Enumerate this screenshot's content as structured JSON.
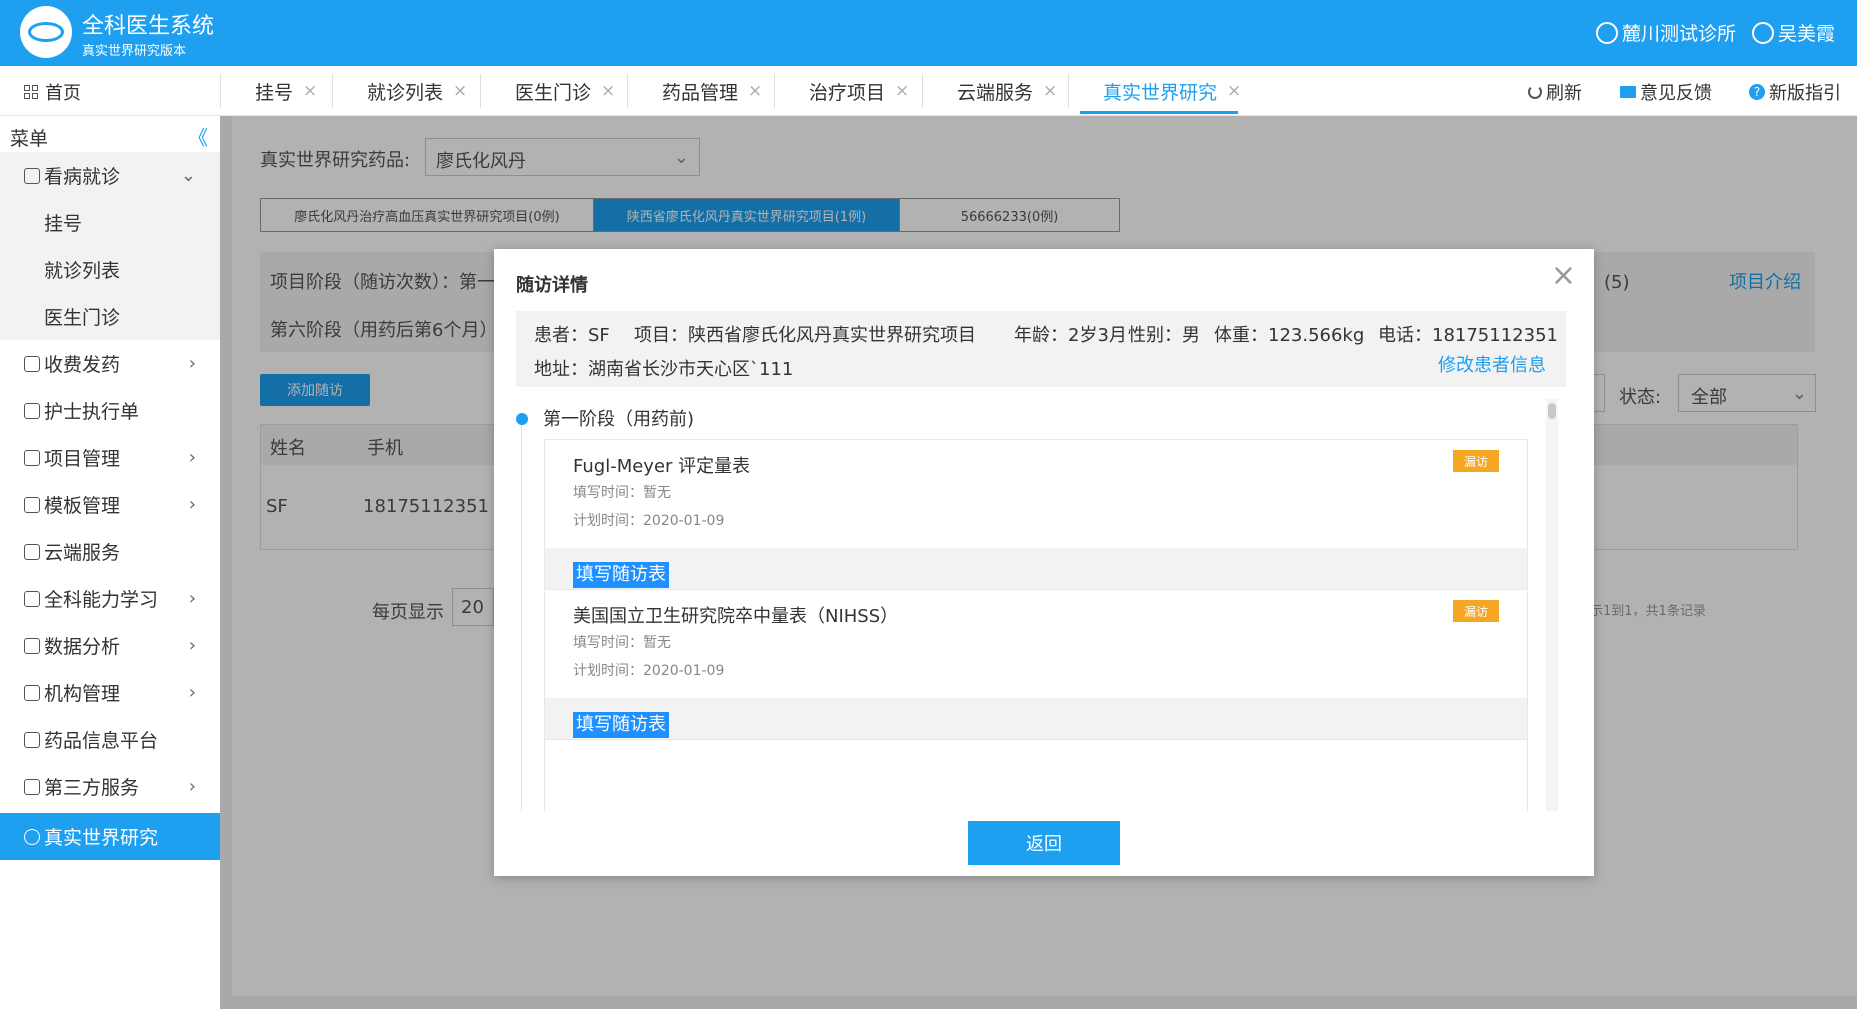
{
  "header": {
    "title": "全科医生系统",
    "subtitle": "真实世界研究版本",
    "clinic": "麓川测试诊所",
    "user": "吴美霞"
  },
  "tabs": {
    "home": "首页",
    "items": [
      {
        "label": "挂号",
        "close": "×"
      },
      {
        "label": "就诊列表",
        "close": "×"
      },
      {
        "label": "医生门诊",
        "close": "×"
      },
      {
        "label": "药品管理",
        "close": "×"
      },
      {
        "label": "治疗项目",
        "close": "×"
      },
      {
        "label": "云端服务",
        "close": "×"
      },
      {
        "label": "真实世界研究",
        "close": "×"
      }
    ],
    "refresh": "刷新",
    "feedback": "意见反馈",
    "guide": "新版指引"
  },
  "sidebar": {
    "menu_label": "菜单",
    "collapse_glyph": "《",
    "items": [
      {
        "label": "看病就诊",
        "chev": "⌄"
      },
      {
        "label": "挂号"
      },
      {
        "label": "就诊列表"
      },
      {
        "label": "医生门诊"
      },
      {
        "label": "收费发药",
        "chev": "›"
      },
      {
        "label": "护士执行单"
      },
      {
        "label": "项目管理",
        "chev": "›"
      },
      {
        "label": "模板管理",
        "chev": "›"
      },
      {
        "label": "云端服务"
      },
      {
        "label": "全科能力学习",
        "chev": "›"
      },
      {
        "label": "数据分析",
        "chev": "›"
      },
      {
        "label": "机构管理",
        "chev": "›"
      },
      {
        "label": "药品信息平台"
      },
      {
        "label": "第三方服务",
        "chev": "›"
      },
      {
        "label": "真实世界研究"
      }
    ]
  },
  "page": {
    "drug_label": "真实世界研究药品:",
    "drug_value": "廖氏化风丹",
    "caret": "⌄",
    "project_tabs": [
      "廖氏化风丹治疗高血压真实世界研究项目(0例)",
      "陕西省廖氏化风丹真实世界研究项目(1例)",
      "56666233(0例)"
    ],
    "stage_line1": "项目阶段（随访次数）：第一",
    "stage_count": "）(5)",
    "stage_line2": "第六阶段（用药后第6个月）",
    "intro_link": "项目介绍",
    "add_button": "添加随访",
    "status_label": "状态:",
    "status_value": "全部",
    "table_headers": [
      "姓名",
      "手机"
    ],
    "table_row": [
      "SF",
      "18175112351"
    ],
    "pager_label": "每页显示",
    "pager_value": "20",
    "pager_info": "示1到1，共1条记录"
  },
  "modal": {
    "title": "随访详情",
    "close": "×",
    "patient": "患者：SF",
    "project": "项目：陕西省廖氏化风丹真实世界研究项目",
    "age": "年龄：2岁3月",
    "gender": "性别：男",
    "weight": "体重：123.566kg",
    "phone": "电话：18175112351",
    "address": "地址：湖南省长沙市天心区`111",
    "edit_link": "修改患者信息",
    "stage_title": "第一阶段（用药前)",
    "cards": [
      {
        "title": "Fugl-Meyer 评定量表",
        "badge": "漏访",
        "fill_time": "填写时间：暂无",
        "plan_time": "计划时间：2020-01-09",
        "button": "填写随访表"
      },
      {
        "title": "美国国立卫生研究院卒中量表（NIHSS）",
        "badge": "漏访",
        "fill_time": "填写时间：暂无",
        "plan_time": "计划时间：2020-01-09",
        "button": "填写随访表"
      }
    ],
    "return_button": "返回"
  },
  "colors": {
    "primary": "#1e9fef",
    "badge": "#f5a623",
    "overlay": "rgba(0,0,0,0.30)"
  }
}
